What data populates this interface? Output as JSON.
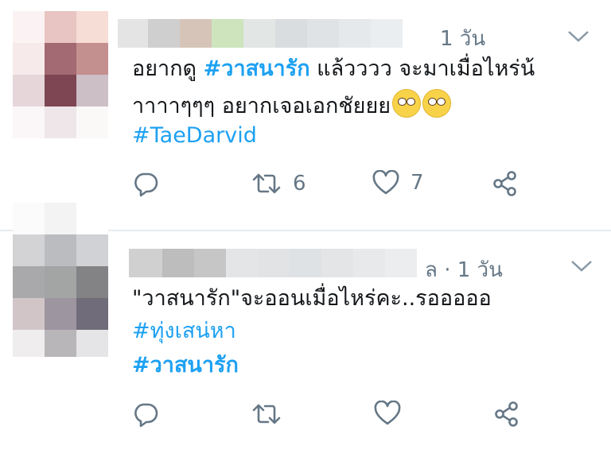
{
  "tweets": [
    {
      "time": "1 วัน",
      "text_line1_pre": "อยากดู ",
      "text_line1_tag": "#วาสนารัก",
      "text_line1_post": " แล้วววว จะมาเมื่อไหร่น้",
      "text_line2": "าาาาๆๆๆ อยากเจอเอกชัยยย",
      "emoji": [
        "face-with-rolling-eyes-emoji",
        "face-with-rolling-eyes-emoji"
      ],
      "hashtag": "#TaeDarvid",
      "retweets": "6",
      "likes": "7"
    },
    {
      "time_prefix": "ล · ",
      "time": "1 วัน",
      "text_line1": "\"วาสนารัก\"จะออนเมื่อไหร่คะ..รอออออ",
      "hashtag1": "#ทุ่งเสน่หา",
      "hashtag2": "#วาสนารัก"
    }
  ],
  "colors": {
    "link": "#1da1f2",
    "muted": "#657786",
    "divider": "#e6ecf0"
  },
  "icons": [
    "reply-icon",
    "retweet-icon",
    "like-icon",
    "share-icon",
    "chevron-down-icon"
  ]
}
